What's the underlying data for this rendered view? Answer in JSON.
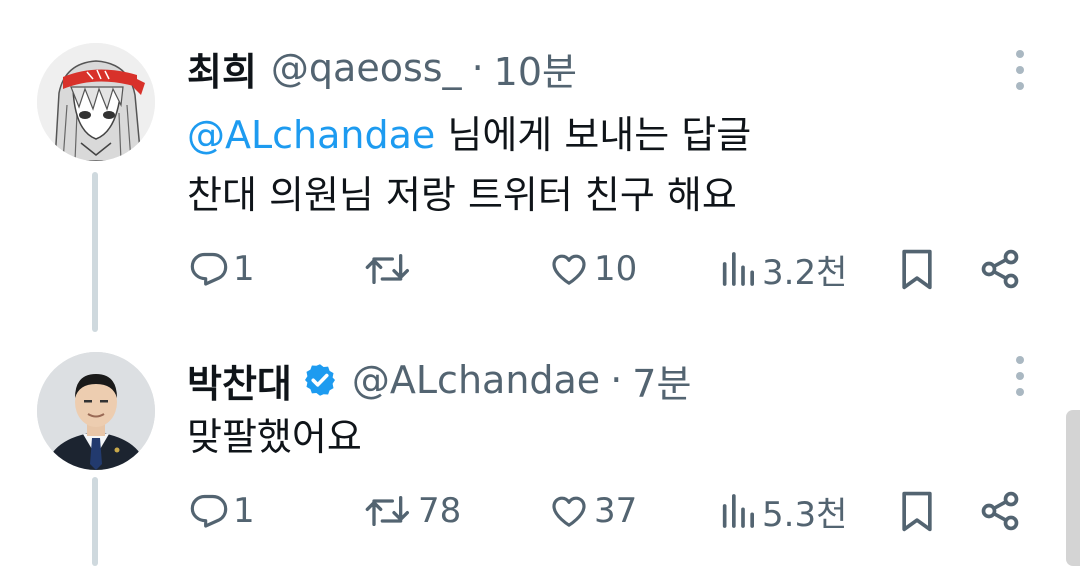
{
  "colors": {
    "accent": "#1d9bf0",
    "text": "#0f1419",
    "secondary": "#536471",
    "thread_line": "#cfd9de"
  },
  "tweets": [
    {
      "author_name": "최희",
      "handle": "@qaeoss_",
      "separator": "·",
      "time": "10분",
      "verified": false,
      "avatar": "anime-girl-avatar",
      "reply_to": {
        "mention": "@ALchandae",
        "suffix": " 님에게 보내는 답글"
      },
      "text": "찬대 의원님 저랑 트위터 친구 해요",
      "stats": {
        "replies": "1",
        "retweets": "",
        "likes": "10",
        "views": "3.2천"
      }
    },
    {
      "author_name": "박찬대",
      "handle": "@ALchandae",
      "separator": "·",
      "time": "7분",
      "verified": true,
      "avatar": "man-in-suit-avatar",
      "text": "맞팔했어요",
      "stats": {
        "replies": "1",
        "retweets": "78",
        "likes": "37",
        "views": "5.3천"
      }
    }
  ],
  "icons": {
    "reply": "reply-icon",
    "retweet": "retweet-icon",
    "like": "heart-icon",
    "views": "views-icon",
    "bookmark": "bookmark-icon",
    "share": "share-icon",
    "more": "more-vertical-icon",
    "verified": "verified-badge-icon"
  }
}
